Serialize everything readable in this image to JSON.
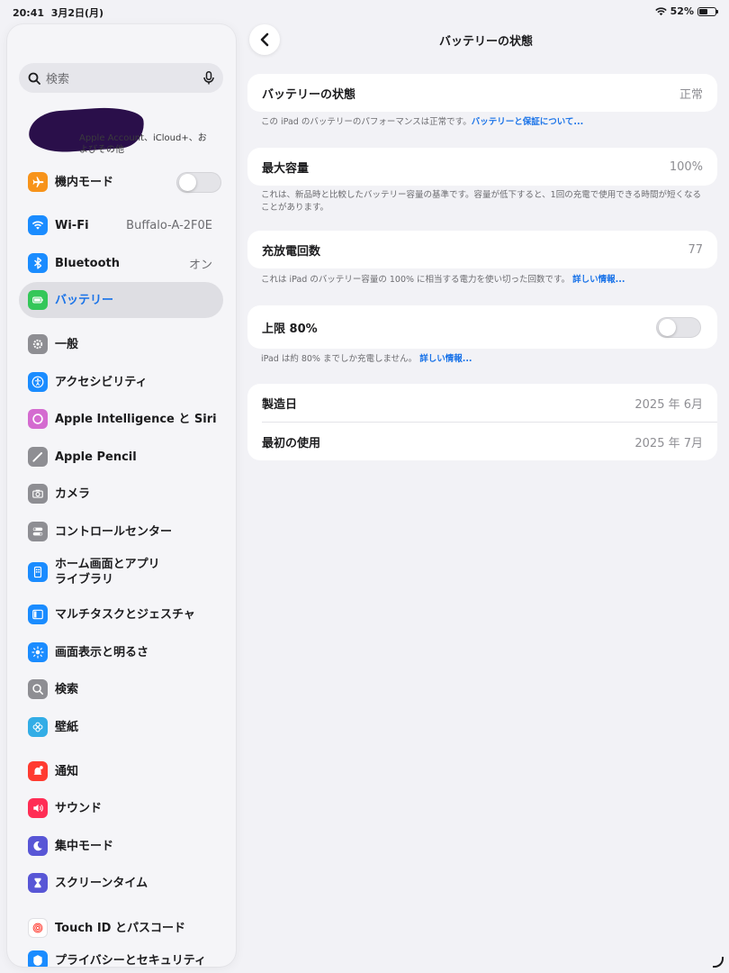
{
  "status": {
    "time": "20:41",
    "date": "3月2日(月)",
    "battery_pct": "52%"
  },
  "sidebar": {
    "search_placeholder": "検索",
    "account_sub": "Apple Account、iCloud+、およびその他",
    "items": [
      {
        "label": "機内モード",
        "icon": "airplane-icon",
        "color": "#f7931a",
        "toggle": false
      },
      {
        "label": "Wi-Fi",
        "icon": "wifi-icon",
        "color": "#1a8cff",
        "value": "Buffalo-A-2F0E"
      },
      {
        "label": "Bluetooth",
        "icon": "bluetooth-icon",
        "color": "#1a8cff",
        "value": "オン"
      },
      {
        "label": "バッテリー",
        "icon": "battery-icon",
        "color": "#34c759",
        "active": true
      },
      {
        "label": "一般",
        "icon": "gear-icon",
        "color": "#8e8e93"
      },
      {
        "label": "アクセシビリティ",
        "icon": "accessibility-icon",
        "color": "#1a8cff"
      },
      {
        "label": "Apple Intelligence と Siri",
        "icon": "siri-icon",
        "color": "#d46bd0"
      },
      {
        "label": "Apple Pencil",
        "icon": "pencil-icon",
        "color": "#8e8e93"
      },
      {
        "label": "カメラ",
        "icon": "camera-icon",
        "color": "#8e8e93"
      },
      {
        "label": "コントロールセンター",
        "icon": "control-center-icon",
        "color": "#8e8e93"
      },
      {
        "label": "ホーム画面とアプリ\nライブラリ",
        "icon": "home-screen-icon",
        "color": "#1a8cff"
      },
      {
        "label": "マルチタスクとジェスチャ",
        "icon": "multitask-icon",
        "color": "#1a8cff"
      },
      {
        "label": "画面表示と明るさ",
        "icon": "brightness-icon",
        "color": "#1a8cff"
      },
      {
        "label": "検索",
        "icon": "search-icon",
        "color": "#8e8e93"
      },
      {
        "label": "壁紙",
        "icon": "wallpaper-icon",
        "color": "#32ade6"
      },
      {
        "label": "通知",
        "icon": "notification-icon",
        "color": "#ff3b30"
      },
      {
        "label": "サウンド",
        "icon": "sound-icon",
        "color": "#ff2d55"
      },
      {
        "label": "集中モード",
        "icon": "moon-icon",
        "color": "#5856d6"
      },
      {
        "label": "スクリーンタイム",
        "icon": "hourglass-icon",
        "color": "#5856d6"
      },
      {
        "label": "Touch ID とパスコード",
        "icon": "fingerprint-icon",
        "color": "#ffffff"
      },
      {
        "label": "プライバシーとセキュリティ",
        "icon": "privacy-icon",
        "color": "#1a8cff"
      }
    ]
  },
  "main": {
    "title": "バッテリーの状態",
    "health": {
      "label": "バッテリーの状態",
      "value": "正常"
    },
    "health_note": {
      "text": "この iPad のバッテリーのパフォーマンスは正常です。",
      "link": "バッテリーと保証について..."
    },
    "capacity": {
      "label": "最大容量",
      "value": "100%"
    },
    "capacity_note": {
      "text": "これは、新品時と比較したバッテリー容量の基準です。容量が低下すると、1回の充電で使用できる時間が短くなることがあります。"
    },
    "cycles": {
      "label": "充放電回数",
      "value": "77"
    },
    "cycles_note": {
      "text": "これは iPad のバッテリー容量の 100% に相当する電力を使い切った回数です。",
      "link": "詳しい情報..."
    },
    "limit": {
      "label": "上限 80%",
      "toggle": false
    },
    "limit_note": {
      "text": "iPad は約 80% までしか充電しません。",
      "link": "詳しい情報..."
    },
    "manufacture": {
      "label": "製造日",
      "value": "2025 年 6月"
    },
    "first_use": {
      "label": "最初の使用",
      "value": "2025 年 7月"
    }
  }
}
